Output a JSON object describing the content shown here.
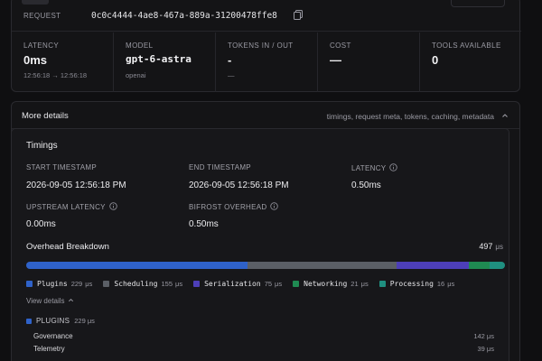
{
  "request": {
    "label": "REQUEST",
    "id": "0c0c4444-4ae8-467a-889a-31200478ffe8"
  },
  "metrics": [
    {
      "label": "LATENCY",
      "value": "0ms",
      "sub": "12:56:18 → 12:56:18",
      "mono": false
    },
    {
      "label": "MODEL",
      "value": "gpt-6-astra",
      "sub": "openai",
      "mono": true
    },
    {
      "label": "TOKENS IN / OUT",
      "value": "-",
      "sub": "—",
      "mono": false
    },
    {
      "label": "COST",
      "value": "—",
      "sub": "",
      "mono": false
    },
    {
      "label": "TOOLS AVAILABLE",
      "value": "0",
      "sub": "",
      "mono": false
    }
  ],
  "details": {
    "title": "More details",
    "hint": "timings, request meta, tokens, caching, metadata"
  },
  "timings": {
    "title": "Timings",
    "start_label": "START TIMESTAMP",
    "start_value": "2026-09-05 12:56:18 PM",
    "end_label": "END TIMESTAMP",
    "end_value": "2026-09-05 12:56:18 PM",
    "latency_label": "LATENCY",
    "latency_value": "0.50ms",
    "upstream_label": "UPSTREAM LATENCY",
    "upstream_value": "0.00ms",
    "overhead_label": "BIFROST OVERHEAD",
    "overhead_value": "0.50ms"
  },
  "overhead": {
    "title": "Overhead Breakdown",
    "total": "497",
    "unit": "μs",
    "segments": [
      {
        "name": "Plugins",
        "value": 229,
        "color": "#2f62c9"
      },
      {
        "name": "Scheduling",
        "value": 155,
        "color": "#5b5f66"
      },
      {
        "name": "Serialization",
        "value": 75,
        "color": "#4d3fb8"
      },
      {
        "name": "Networking",
        "value": 21,
        "color": "#1f8a52"
      },
      {
        "name": "Processing",
        "value": 16,
        "color": "#1f8f80"
      }
    ],
    "view_details": "View details"
  },
  "plugins": {
    "label": "PLUGINS",
    "value": "229",
    "unit": "μs",
    "rows": [
      {
        "name": "Governance",
        "value": "142",
        "unit": "μs"
      },
      {
        "name": "Telemetry",
        "value": "39",
        "unit": "μs"
      }
    ]
  }
}
